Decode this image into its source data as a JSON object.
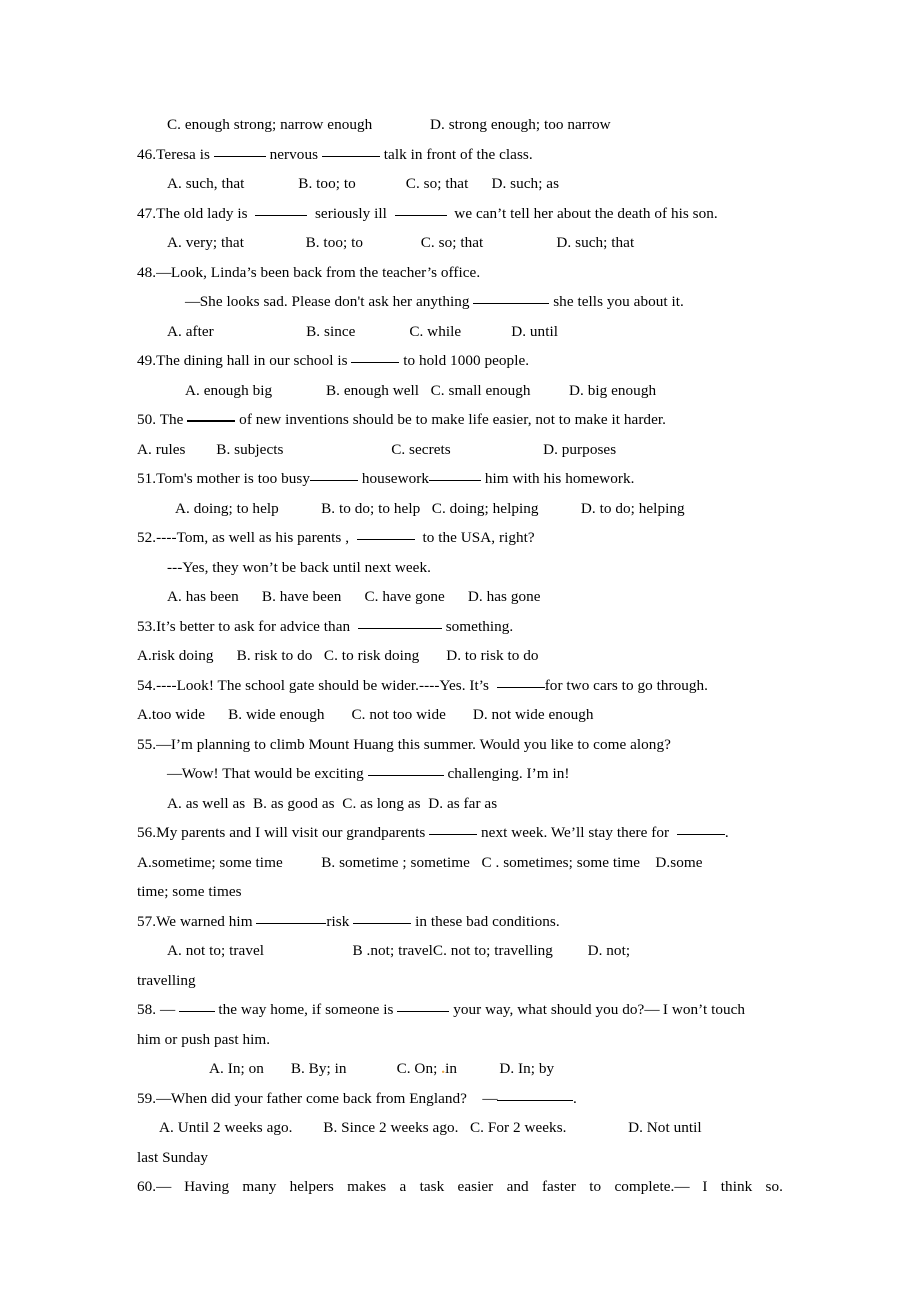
{
  "document": {
    "type": "english-grammar-multiple-choice-worksheet",
    "page_background": "#ffffff",
    "text_color": "#000000",
    "lines": [
      {
        "id": "q45-options-cd",
        "kind": "options",
        "indent": 3,
        "text": "C. enough strong; narrow enough               D. strong enough; too narrow"
      },
      {
        "id": "q46-stem",
        "kind": "stem",
        "indent": 0,
        "text": "46.Teresa is ______ nervous _______ talk in front of the class."
      },
      {
        "id": "q46-options",
        "kind": "options",
        "indent": 3,
        "text": "A. such, that              B. too; to             C. so; that      D. such; as"
      },
      {
        "id": "q47-stem",
        "kind": "stem",
        "indent": 0,
        "text": "47.The old lady is  ______  seriously ill  ______  we can’t tell her about the death of his son."
      },
      {
        "id": "q47-options",
        "kind": "options",
        "indent": 3,
        "text": "A. very; that                B. too; to               C. so; that                   D. such; that"
      },
      {
        "id": "q48-stem",
        "kind": "stem",
        "indent": 0,
        "text": "48.—Look, Linda’s been back from the teacher’s office."
      },
      {
        "id": "q48-stem-2",
        "kind": "stem",
        "indent": 5,
        "text": "—She looks sad. Please don't ask her anything _________ she tells you about it."
      },
      {
        "id": "q48-options",
        "kind": "options",
        "indent": 3,
        "text": "A. after                        B. since              C. while             D. until"
      },
      {
        "id": "q49-stem",
        "kind": "stem",
        "indent": 0,
        "text": "49.The dining hall in our school is ______ to hold 1000 people."
      },
      {
        "id": "q49-options",
        "kind": "options",
        "indent": 5,
        "text": "A. enough big              B. enough well   C. small enough          D. big enough"
      },
      {
        "id": "q50-stem",
        "kind": "stem",
        "indent": 0,
        "text": "50. The ______ of new inventions should be to make life easier, not to make it harder."
      },
      {
        "id": "q50-options",
        "kind": "options",
        "indent": 0,
        "text": "A. rules        B. subjects                            C. secrets                        D. purposes"
      },
      {
        "id": "q51-stem",
        "kind": "stem",
        "indent": 0,
        "text": "51.Tom's mother is too busy______ housework_______ him with his homework."
      },
      {
        "id": "q51-options",
        "kind": "options",
        "indent": 4,
        "text": "A. doing; to help           B. to do; to help   C. doing; helping           D. to do; helping"
      },
      {
        "id": "q52-stem",
        "kind": "stem",
        "indent": 0,
        "text": "52.----Tom, as well as his parents ,  _______  to the USA, right?"
      },
      {
        "id": "q52-stem-2",
        "kind": "stem",
        "indent": 3,
        "text": "---Yes, they won’t be back until next week."
      },
      {
        "id": "q52-options",
        "kind": "options",
        "indent": 3,
        "text": "A. has been      B. have been      C. have gone      D. has gone"
      },
      {
        "id": "q53-stem",
        "kind": "stem",
        "indent": 0,
        "text": "53.It’s better to ask for advice than  __________ something."
      },
      {
        "id": "q53-options",
        "kind": "options",
        "indent": 0,
        "text": "A.risk doing      B. risk to do   C. to risk doing       D. to risk to do"
      },
      {
        "id": "q54-stem",
        "kind": "stem",
        "indent": 0,
        "text": "54.----Look! The school gate should be wider.----Yes. It’s  ______for two cars to go through."
      },
      {
        "id": "q54-options",
        "kind": "options",
        "indent": 0,
        "text": "A.too wide      B. wide enough       C. not too wide       D. not wide enough"
      },
      {
        "id": "q55-stem",
        "kind": "stem",
        "indent": 0,
        "text": "55.—I’m planning to climb Mount Huang this summer. Would you like to come along?"
      },
      {
        "id": "q55-stem-2",
        "kind": "stem",
        "indent": 3,
        "text": "—Wow! That would be exciting __________ challenging. I’m in!"
      },
      {
        "id": "q55-options",
        "kind": "options",
        "indent": 3,
        "text": "A. as well as  B. as good as  C. as long as  D. as far as"
      },
      {
        "id": "q56-stem",
        "kind": "stem",
        "indent": 0,
        "text": "56.My parents and I will visit our grandparents ______ next week. We’ll stay there for  ______."
      },
      {
        "id": "q56-options",
        "kind": "options",
        "indent": 0,
        "text": "A.sometime; some time          B. sometime ; sometime   C . sometimes; some time    D.some"
      },
      {
        "id": "q56-options-wrap",
        "kind": "options",
        "indent": 0,
        "text": "time; some times"
      },
      {
        "id": "q57-stem",
        "kind": "stem",
        "indent": 0,
        "text": "57.We warned him _________risk ________ in these bad conditions."
      },
      {
        "id": "q57-options",
        "kind": "options",
        "indent": 3,
        "text": "A. not to; travel                       B .not; travelC. not to; travelling         D. not;"
      },
      {
        "id": "q57-options-wrap",
        "kind": "options",
        "indent": 0,
        "text": "travelling"
      },
      {
        "id": "q58-stem",
        "kind": "stem",
        "indent": 0,
        "text": "58. — ____ the way home, if someone is ______ your way, what should you do?— I won’t touch"
      },
      {
        "id": "q58-stem-wrap",
        "kind": "stem",
        "indent": 0,
        "text": "him or push past him."
      },
      {
        "id": "q58-options",
        "kind": "options",
        "indent": 7,
        "text": "A. In; on       B. By; in             C. On;  .in           D. In; by"
      },
      {
        "id": "q59-stem",
        "kind": "stem",
        "indent": 0,
        "text": "59.—When did your father come back from England?    —__________."
      },
      {
        "id": "q59-options",
        "kind": "options",
        "indent": 2,
        "text": "A. Until 2 weeks ago.        B. Since 2 weeks ago.   C. For 2 weeks.                D. Not until"
      },
      {
        "id": "q59-options-wrap",
        "kind": "options",
        "indent": 0,
        "text": "last Sunday"
      },
      {
        "id": "q60-stem",
        "kind": "stem",
        "indent": 0,
        "justified": true,
        "text": "60.— Having many helpers makes a task easier and faster to complete.— I think so."
      }
    ]
  },
  "annotations": {
    "orange_mark": {
      "text": ".",
      "color": "#e8a33d",
      "near": "C. On; in  (option C of question 58)"
    }
  }
}
